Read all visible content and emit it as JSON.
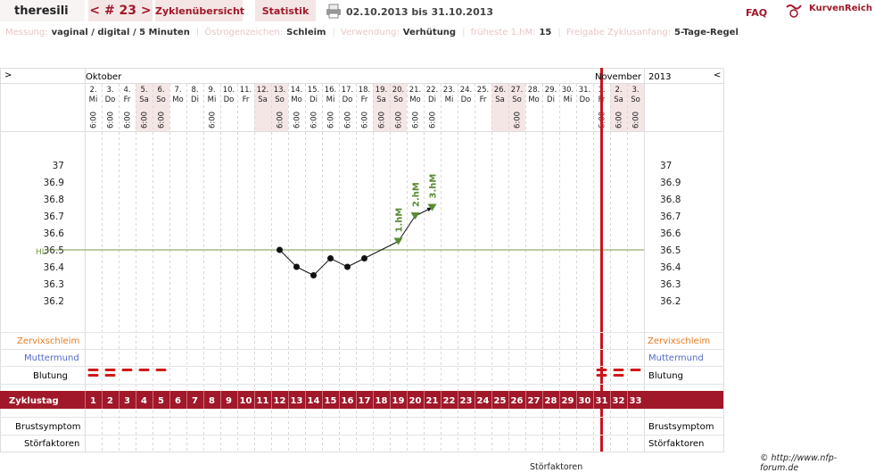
{
  "header": {
    "username": "theresili",
    "cycle_nav": "< # 23 >",
    "tab_overview": "Zyklenübersicht",
    "tab_stats": "Statistik",
    "date_range": "02.10.2013 bis 31.10.2013",
    "faq": "FAQ",
    "brand": "KurvenReich"
  },
  "settings": [
    {
      "label": "Messung:",
      "value": "vaginal / digital / 5 Minuten"
    },
    {
      "label": "Östrogenzeichen:",
      "value": "Schleim"
    },
    {
      "label": "Verwendung:",
      "value": "Verhütung"
    },
    {
      "label": "früheste 1.hM:",
      "value": "15"
    },
    {
      "label": "Freigabe Zyklusanfang:",
      "value": "5-Tage-Regel"
    }
  ],
  "chart": {
    "nav_left": ">",
    "nav_right": "<",
    "month1": "Oktober",
    "month2": "November",
    "year": "2013",
    "coverline_label": "HL",
    "temps": [
      "37",
      "36.9",
      "36.8",
      "36.7",
      "36.6",
      "36.5",
      "36.4",
      "36.3",
      "36.2"
    ],
    "rows": {
      "zervix": "Zervixschleim",
      "muttermund": "Muttermund",
      "blutung": "Blutung",
      "zyklustag": "Zyklustag",
      "brust": "Brustsymptom",
      "stoer": "Störfaktoren"
    },
    "marker_labels": [
      "1.hM",
      "2.hM",
      "3.hM"
    ]
  },
  "chart_data": {
    "type": "line",
    "days": [
      {
        "d": "2.",
        "w": "Mi",
        "t": "6:00",
        "we": false
      },
      {
        "d": "3.",
        "w": "Do",
        "t": "6:00",
        "we": false
      },
      {
        "d": "4.",
        "w": "Fr",
        "t": "6:00",
        "we": false
      },
      {
        "d": "5.",
        "w": "Sa",
        "t": "6:00",
        "we": true
      },
      {
        "d": "6.",
        "w": "So",
        "t": "6:00",
        "we": true
      },
      {
        "d": "7.",
        "w": "Mo",
        "t": "",
        "we": false
      },
      {
        "d": "8.",
        "w": "Di",
        "t": "",
        "we": false
      },
      {
        "d": "9.",
        "w": "Mi",
        "t": "6:00",
        "we": false
      },
      {
        "d": "10.",
        "w": "Do",
        "t": "",
        "we": false
      },
      {
        "d": "11.",
        "w": "Fr",
        "t": "",
        "we": false
      },
      {
        "d": "12.",
        "w": "Sa",
        "t": "",
        "we": true
      },
      {
        "d": "13.",
        "w": "So",
        "t": "6:00",
        "we": true
      },
      {
        "d": "14.",
        "w": "Mo",
        "t": "6:00",
        "we": false
      },
      {
        "d": "15.",
        "w": "Di",
        "t": "6:00",
        "we": false
      },
      {
        "d": "16.",
        "w": "Mi",
        "t": "6:00",
        "we": false
      },
      {
        "d": "17.",
        "w": "Do",
        "t": "6:00",
        "we": false
      },
      {
        "d": "18.",
        "w": "Fr",
        "t": "6:00",
        "we": false
      },
      {
        "d": "19.",
        "w": "Sa",
        "t": "6:00",
        "we": true
      },
      {
        "d": "20.",
        "w": "So",
        "t": "6:00",
        "we": true
      },
      {
        "d": "21.",
        "w": "Mo",
        "t": "6:00",
        "we": false
      },
      {
        "d": "22.",
        "w": "Di",
        "t": "6:00",
        "we": false
      },
      {
        "d": "23.",
        "w": "Mi",
        "t": "",
        "we": false
      },
      {
        "d": "24.",
        "w": "Do",
        "t": "",
        "we": false
      },
      {
        "d": "25.",
        "w": "Fr",
        "t": "",
        "we": false
      },
      {
        "d": "26.",
        "w": "Sa",
        "t": "",
        "we": true
      },
      {
        "d": "27.",
        "w": "So",
        "t": "6:00",
        "we": true
      },
      {
        "d": "28.",
        "w": "Mo",
        "t": "",
        "we": false
      },
      {
        "d": "29.",
        "w": "Di",
        "t": "",
        "we": false
      },
      {
        "d": "30.",
        "w": "Mi",
        "t": "",
        "we": false
      },
      {
        "d": "31.",
        "w": "Do",
        "t": "",
        "we": false
      },
      {
        "d": "1.",
        "w": "Fr",
        "t": "6:00",
        "we": false
      },
      {
        "d": "2.",
        "w": "Sa",
        "t": "6:00",
        "we": true
      },
      {
        "d": "3.",
        "w": "So",
        "t": "6:00",
        "we": true
      }
    ],
    "cycle_days": [
      "1",
      "2",
      "3",
      "4",
      "5",
      "6",
      "7",
      "8",
      "9",
      "10",
      "11",
      "12",
      "13",
      "14",
      "15",
      "16",
      "17",
      "18",
      "19",
      "20",
      "21",
      "22",
      "23",
      "24",
      "25",
      "26",
      "27",
      "28",
      "29",
      "30",
      "31",
      "32",
      "33"
    ],
    "temperatures": [
      {
        "day": 12,
        "temp": 36.5
      },
      {
        "day": 13,
        "temp": 36.4
      },
      {
        "day": 14,
        "temp": 36.35
      },
      {
        "day": 15,
        "temp": 36.45
      },
      {
        "day": 16,
        "temp": 36.4
      },
      {
        "day": 17,
        "temp": 36.45
      },
      {
        "day": 19,
        "temp": 36.55
      },
      {
        "day": 20,
        "temp": 36.7
      },
      {
        "day": 21,
        "temp": 36.75
      }
    ],
    "coverline": 36.5,
    "high_markers": [
      19,
      20,
      21
    ],
    "bleeding": [
      {
        "day": 1,
        "level": 2
      },
      {
        "day": 2,
        "level": 2
      },
      {
        "day": 3,
        "level": 1
      },
      {
        "day": 4,
        "level": 1
      },
      {
        "day": 5,
        "level": 1
      },
      {
        "day": 31,
        "level": 2
      },
      {
        "day": 32,
        "level": 2
      },
      {
        "day": 33,
        "level": 1
      }
    ],
    "ylim": [
      36.1,
      37.0
    ],
    "today_line_day": 30.5
  },
  "footer": {
    "copyright": "© http://www.nfp-forum.de",
    "cut_text": "Störfaktoren"
  },
  "colors": {
    "accent": "#a0182a",
    "weekend": "#f5e6e6",
    "coverline": "#7a9a4a",
    "zervix": "#e87a1e",
    "muttermund": "#5569c8",
    "today": "#c8141e"
  }
}
